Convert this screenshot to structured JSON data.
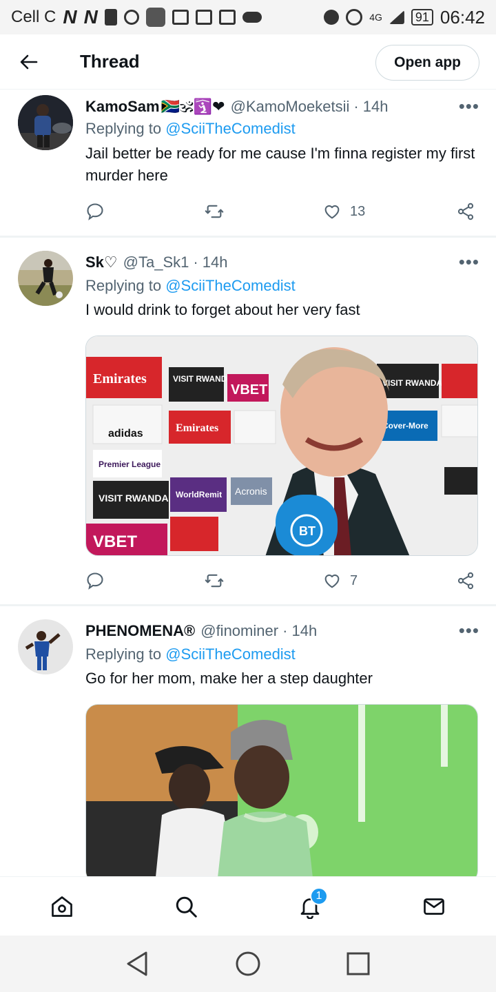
{
  "statusbar": {
    "carrier": "Cell C",
    "network_glyph_a": "N",
    "network_glyph_b": "N",
    "signal": "4G",
    "battery": "91",
    "time": "06:42"
  },
  "header": {
    "title": "Thread",
    "open_app_label": "Open app"
  },
  "tweets": [
    {
      "name": "KamoSam",
      "name_emojis": "🇿🇦🕉🛐❤",
      "handle": "@KamoMoeketsii",
      "time": "· 14h",
      "replying_label": "Replying to ",
      "replying_to": "@SciiTheComedist",
      "text": "Jail better be ready for me cause I'm finna register my first murder here",
      "likes": "13"
    },
    {
      "name": "Sk♡",
      "handle": "@Ta_Sk1",
      "time": "· 14h",
      "replying_label": "Replying to ",
      "replying_to": "@SciiTheComedist",
      "text": "I would drink to forget about her very fast",
      "likes": "7",
      "media_text": {
        "pl": "Premier League",
        "emirates": "Emirates",
        "visit": "VISIT RWANDA",
        "vbet": "VBET",
        "adidas": "adidas",
        "worldremit": "WorldRemit",
        "covermore": "Cover-More",
        "acronis": "Acronis",
        "bt": "BT"
      }
    },
    {
      "name": "PHENOMENA®",
      "handle": "@finominer",
      "time": "· 14h",
      "replying_label": "Replying to ",
      "replying_to": "@SciiTheComedist",
      "text": "Go for her mom, make her a step daughter"
    }
  ],
  "bottomnav": {
    "notifications_count": "1"
  },
  "colors": {
    "accent": "#1d9bf0",
    "secondary_text": "#536471",
    "like_heart": "#536471"
  },
  "icons": [
    "back-arrow-icon",
    "more-icon",
    "reply-icon",
    "retweet-icon",
    "heart-icon",
    "share-icon",
    "home-icon",
    "search-icon",
    "bell-icon",
    "mail-icon",
    "back-triangle-icon",
    "home-circle-icon",
    "recents-square-icon"
  ]
}
